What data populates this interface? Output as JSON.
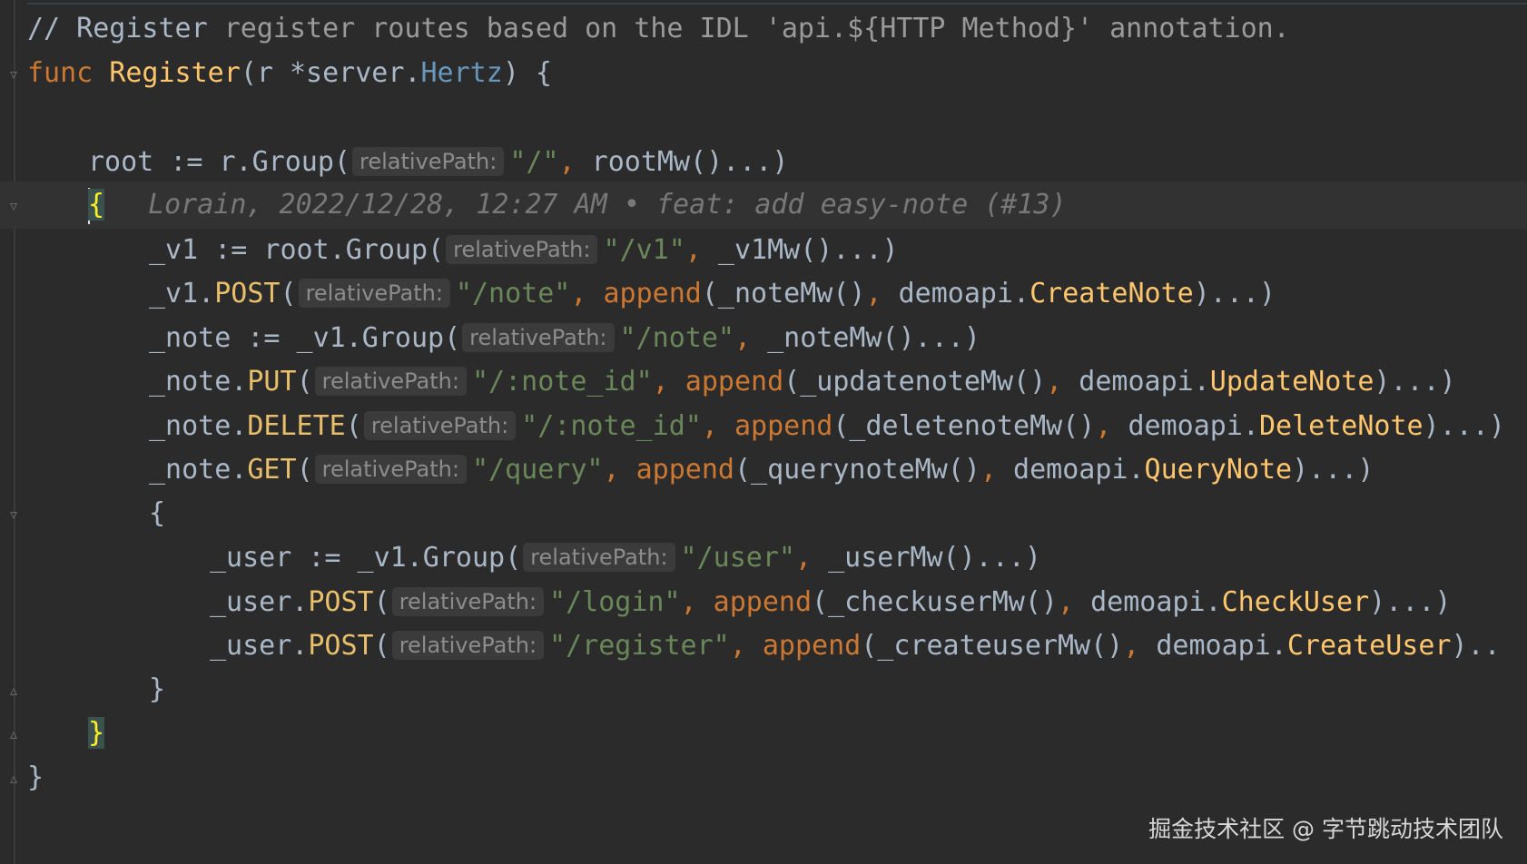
{
  "editor": {
    "lines": [
      {
        "indent": 0,
        "fold": "",
        "current": false,
        "tokens": [
          {
            "t": "// Register",
            "c": "comment"
          },
          {
            "t": " register routes based on the IDL 'api.${HTTP Method}' annotation.",
            "c": "comment-gray"
          }
        ]
      },
      {
        "indent": 0,
        "fold": "open",
        "current": false,
        "tokens": [
          {
            "t": "func ",
            "c": "kw"
          },
          {
            "t": "Register",
            "c": "fn"
          },
          {
            "t": "(r *server.",
            "c": "plain"
          },
          {
            "t": "Hertz",
            "c": "type"
          },
          {
            "t": ") {",
            "c": "plain"
          }
        ]
      },
      {
        "indent": 0,
        "fold": "",
        "current": false,
        "tokens": []
      },
      {
        "indent": 1,
        "fold": "",
        "current": false,
        "tokens": [
          {
            "t": "root := r.Group(",
            "c": "plain"
          },
          {
            "hint": "relativePath:"
          },
          {
            "t": "\"/\"",
            "c": "str"
          },
          {
            "t": ", ",
            "c": "kw"
          },
          {
            "t": "rootMw()...)",
            "c": "plain"
          }
        ]
      },
      {
        "indent": 1,
        "fold": "open",
        "current": true,
        "tokens": [
          {
            "caret": true
          },
          {
            "t": "{",
            "c": "brace-hl"
          },
          {
            "blame": "Lorain, 2022/12/28, 12:27 AM • feat: add easy-note (#13)"
          }
        ]
      },
      {
        "indent": 2,
        "fold": "",
        "current": false,
        "tokens": [
          {
            "t": "_v1 := root.Group(",
            "c": "plain"
          },
          {
            "hint": "relativePath:"
          },
          {
            "t": "\"/v1\"",
            "c": "str"
          },
          {
            "t": ", ",
            "c": "kw"
          },
          {
            "t": "_v1Mw()...)",
            "c": "plain"
          }
        ]
      },
      {
        "indent": 2,
        "fold": "",
        "current": false,
        "tokens": [
          {
            "t": "_v1.",
            "c": "plain"
          },
          {
            "t": "POST",
            "c": "method"
          },
          {
            "t": "(",
            "c": "plain"
          },
          {
            "hint": "relativePath:"
          },
          {
            "t": "\"/note\"",
            "c": "str"
          },
          {
            "t": ", ",
            "c": "kw"
          },
          {
            "t": "append",
            "c": "kw"
          },
          {
            "t": "(_noteMw()",
            "c": "plain"
          },
          {
            "t": ", ",
            "c": "kw"
          },
          {
            "t": "demoapi.",
            "c": "pkg"
          },
          {
            "t": "CreateNote",
            "c": "call"
          },
          {
            "t": ")...)",
            "c": "plain"
          }
        ]
      },
      {
        "indent": 2,
        "fold": "",
        "current": false,
        "tokens": [
          {
            "t": "_note := _v1.Group(",
            "c": "plain"
          },
          {
            "hint": "relativePath:"
          },
          {
            "t": "\"/note\"",
            "c": "str"
          },
          {
            "t": ", ",
            "c": "kw"
          },
          {
            "t": "_noteMw()...)",
            "c": "plain"
          }
        ]
      },
      {
        "indent": 2,
        "fold": "",
        "current": false,
        "tokens": [
          {
            "t": "_note.",
            "c": "plain"
          },
          {
            "t": "PUT",
            "c": "method"
          },
          {
            "t": "(",
            "c": "plain"
          },
          {
            "hint": "relativePath:"
          },
          {
            "t": "\"/:note_id\"",
            "c": "str"
          },
          {
            "t": ", ",
            "c": "kw"
          },
          {
            "t": "append",
            "c": "kw"
          },
          {
            "t": "(_updatenoteMw()",
            "c": "plain"
          },
          {
            "t": ", ",
            "c": "kw"
          },
          {
            "t": "demoapi.",
            "c": "pkg"
          },
          {
            "t": "UpdateNote",
            "c": "call"
          },
          {
            "t": ")...)",
            "c": "plain"
          }
        ]
      },
      {
        "indent": 2,
        "fold": "",
        "current": false,
        "tokens": [
          {
            "t": "_note.",
            "c": "plain"
          },
          {
            "t": "DELETE",
            "c": "method"
          },
          {
            "t": "(",
            "c": "plain"
          },
          {
            "hint": "relativePath:"
          },
          {
            "t": "\"/:note_id\"",
            "c": "str"
          },
          {
            "t": ", ",
            "c": "kw"
          },
          {
            "t": "append",
            "c": "kw"
          },
          {
            "t": "(_deletenoteMw()",
            "c": "plain"
          },
          {
            "t": ", ",
            "c": "kw"
          },
          {
            "t": "demoapi.",
            "c": "pkg"
          },
          {
            "t": "DeleteNote",
            "c": "call"
          },
          {
            "t": ")...)",
            "c": "plain"
          }
        ]
      },
      {
        "indent": 2,
        "fold": "",
        "current": false,
        "tokens": [
          {
            "t": "_note.",
            "c": "plain"
          },
          {
            "t": "GET",
            "c": "method"
          },
          {
            "t": "(",
            "c": "plain"
          },
          {
            "hint": "relativePath:"
          },
          {
            "t": "\"/query\"",
            "c": "str"
          },
          {
            "t": ", ",
            "c": "kw"
          },
          {
            "t": "append",
            "c": "kw"
          },
          {
            "t": "(_querynoteMw()",
            "c": "plain"
          },
          {
            "t": ", ",
            "c": "kw"
          },
          {
            "t": "demoapi.",
            "c": "pkg"
          },
          {
            "t": "QueryNote",
            "c": "call"
          },
          {
            "t": ")...)",
            "c": "plain"
          }
        ]
      },
      {
        "indent": 2,
        "fold": "open",
        "current": false,
        "tokens": [
          {
            "t": "{",
            "c": "plain"
          }
        ]
      },
      {
        "indent": 3,
        "fold": "",
        "current": false,
        "tokens": [
          {
            "t": "_user := _v1.Group(",
            "c": "plain"
          },
          {
            "hint": "relativePath:"
          },
          {
            "t": "\"/user\"",
            "c": "str"
          },
          {
            "t": ", ",
            "c": "kw"
          },
          {
            "t": "_userMw()...)",
            "c": "plain"
          }
        ]
      },
      {
        "indent": 3,
        "fold": "",
        "current": false,
        "tokens": [
          {
            "t": "_user.",
            "c": "plain"
          },
          {
            "t": "POST",
            "c": "method"
          },
          {
            "t": "(",
            "c": "plain"
          },
          {
            "hint": "relativePath:"
          },
          {
            "t": "\"/login\"",
            "c": "str"
          },
          {
            "t": ", ",
            "c": "kw"
          },
          {
            "t": "append",
            "c": "kw"
          },
          {
            "t": "(_checkuserMw()",
            "c": "plain"
          },
          {
            "t": ", ",
            "c": "kw"
          },
          {
            "t": "demoapi.",
            "c": "pkg"
          },
          {
            "t": "CheckUser",
            "c": "call"
          },
          {
            "t": ")...)",
            "c": "plain"
          }
        ]
      },
      {
        "indent": 3,
        "fold": "",
        "current": false,
        "tokens": [
          {
            "t": "_user.",
            "c": "plain"
          },
          {
            "t": "POST",
            "c": "method"
          },
          {
            "t": "(",
            "c": "plain"
          },
          {
            "hint": "relativePath:"
          },
          {
            "t": "\"/register\"",
            "c": "str"
          },
          {
            "t": ", ",
            "c": "kw"
          },
          {
            "t": "append",
            "c": "kw"
          },
          {
            "t": "(_createuserMw()",
            "c": "plain"
          },
          {
            "t": ", ",
            "c": "kw"
          },
          {
            "t": "demoapi.",
            "c": "pkg"
          },
          {
            "t": "CreateUser",
            "c": "call"
          },
          {
            "t": ")..",
            "c": "plain"
          }
        ]
      },
      {
        "indent": 2,
        "fold": "close",
        "current": false,
        "tokens": [
          {
            "t": "}",
            "c": "plain"
          }
        ]
      },
      {
        "indent": 1,
        "fold": "close",
        "current": false,
        "tokens": [
          {
            "t": "}",
            "c": "brace-hl"
          }
        ]
      },
      {
        "indent": 0,
        "fold": "close",
        "current": false,
        "tokens": [
          {
            "t": "}",
            "c": "plain"
          }
        ]
      }
    ]
  },
  "watermark": "掘金技术社区 @ 字节跳动技术团队",
  "colors": {
    "background": "#2b2b2b",
    "keyword": "#cc7832",
    "function": "#ffc66d",
    "string": "#6a8759",
    "type": "#6897bb",
    "plain": "#a9b7c6",
    "hint_text": "#8c8c8c",
    "hint_bg": "#3b3b3b",
    "brace_highlight": "#ffef28"
  }
}
